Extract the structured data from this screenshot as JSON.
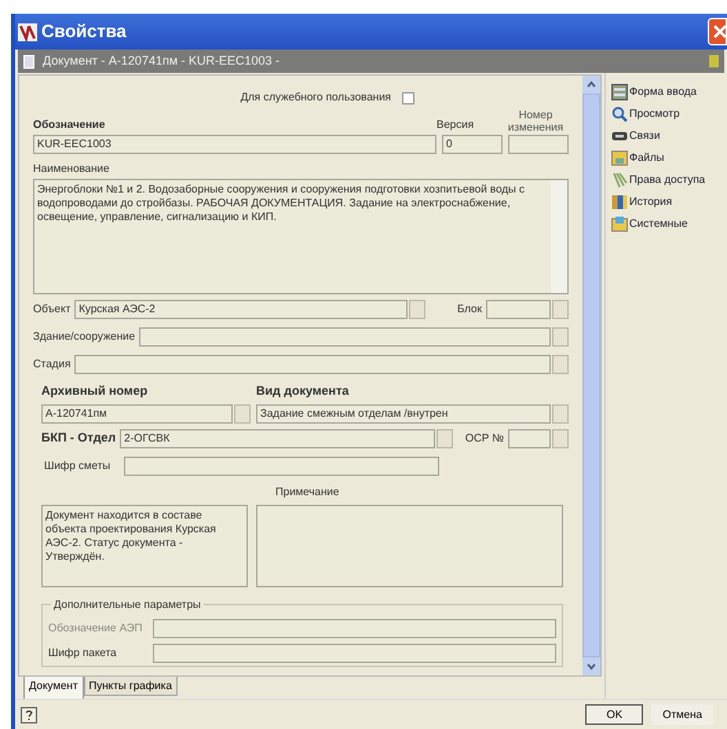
{
  "window": {
    "title": "Свойства"
  },
  "document_bar": {
    "title": "Документ - А-120741пм - KUR-EEC1003 -"
  },
  "official_use": {
    "label": "Для служебного пользования",
    "checked": false
  },
  "designation": {
    "label": "Обозначение",
    "value": "KUR-EEC1003"
  },
  "version": {
    "label": "Версия",
    "value": "0"
  },
  "change_number": {
    "label_line1": "Номер",
    "label_line2": "изменения"
  },
  "name": {
    "label": "Наименование",
    "value": "Энергоблоки №1 и 2. Водозаборные сооружения и сооружения подготовки хозпитьевой воды с водопроводами до стройбазы. РАБОЧАЯ ДОКУМЕНТАЦИЯ. Задание на электроснабжение, освещение, управление, сигнализацию и КИП."
  },
  "object": {
    "label": "Объект",
    "value": "Курская АЭС-2"
  },
  "block": {
    "label": "Блок"
  },
  "building": {
    "label": "Здание/сооружение"
  },
  "stage": {
    "label": "Стадия"
  },
  "archive_number": {
    "label": "Архивный номер",
    "value": "А-120741пм"
  },
  "document_type": {
    "label": "Вид документа",
    "value": "Задание смежным отделам /внутрен"
  },
  "department": {
    "label": "БКП - Отдел",
    "value": "2-ОГСВК"
  },
  "ocr": {
    "label": "ОСР №"
  },
  "estimate_code": {
    "label": "Шифр сметы"
  },
  "status_note": {
    "value": "Документ находится в составе объекта проектирования Курская АЭС-2. Статус документа - Утверждён."
  },
  "remark": {
    "label": "Примечание"
  },
  "extra_params": {
    "title": "Дополнительные параметры",
    "fields": [
      {
        "label": "Обозначение АЭП",
        "disabled": true
      },
      {
        "label": "Шифр пакета",
        "disabled": false
      }
    ]
  },
  "tabs": [
    {
      "label": "Документ",
      "selected": true
    },
    {
      "label": "Пункты графика",
      "selected": false
    }
  ],
  "side_menu": [
    {
      "label": "Форма ввода"
    },
    {
      "label": "Просмотр"
    },
    {
      "label": "Связи"
    },
    {
      "label": "Файлы"
    },
    {
      "label": "Права доступа"
    },
    {
      "label": "История"
    },
    {
      "label": "Системные"
    }
  ],
  "buttons": [
    "OK",
    "Отмена"
  ]
}
